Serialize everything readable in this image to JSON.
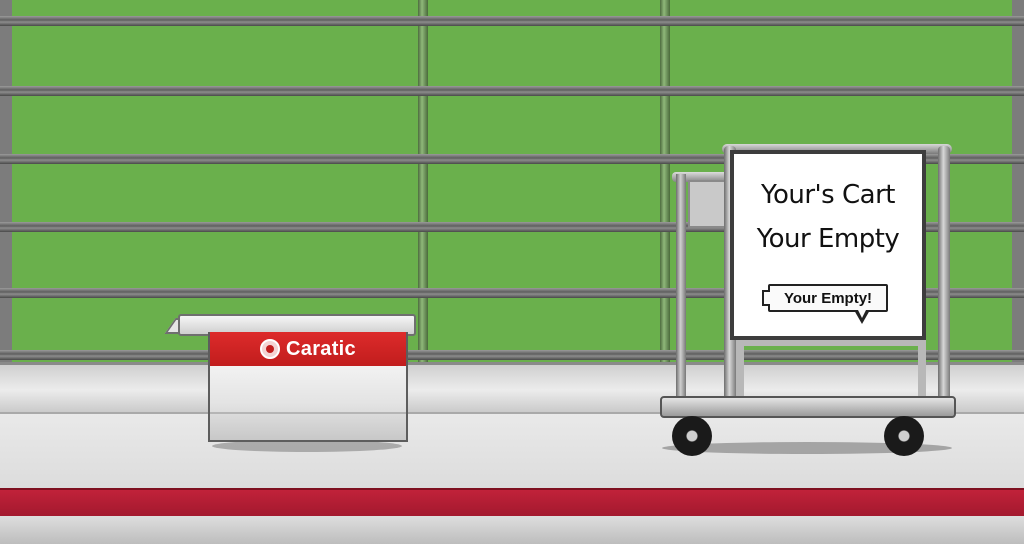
{
  "basket": {
    "label": "Caratic",
    "logo_icon": "circle-emblem-icon",
    "band_color": "#c91f1f"
  },
  "sign": {
    "line1": "Your's Cart",
    "line2": "Your Empty",
    "bubble_text": "Your Empty!"
  },
  "colors": {
    "wall_green": "#6ab04c",
    "floor_stripe_red": "#b31d33",
    "shelf_gray": "#7a7a7a"
  }
}
